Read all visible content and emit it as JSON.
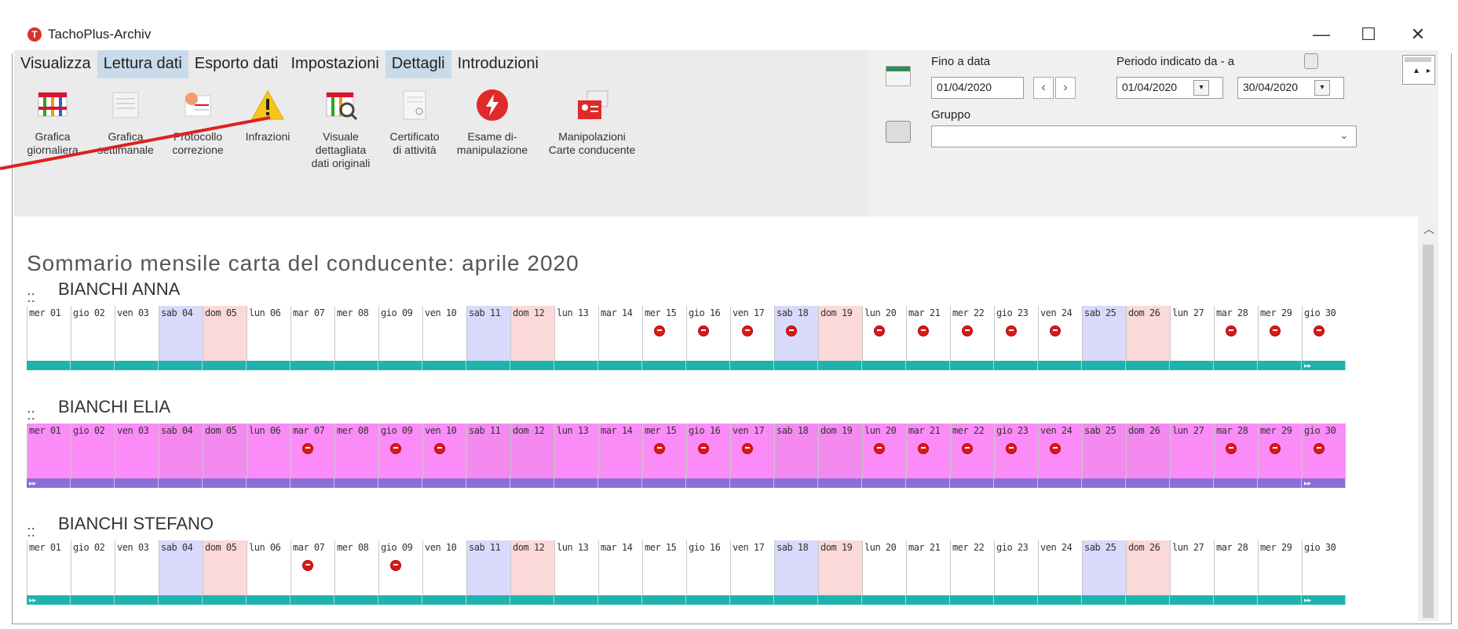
{
  "window": {
    "title": "TachoPlus-Archiv",
    "minimize": "—",
    "maximize": "☐",
    "close": "✕",
    "app_icon_letter": "T"
  },
  "menu": [
    {
      "label": "Visualizza",
      "active": false
    },
    {
      "label": "Lettura dati",
      "active": true
    },
    {
      "label": "Esporto dati",
      "active": false
    },
    {
      "label": "Impostazioni",
      "active": false
    },
    {
      "label": "Dettagli",
      "active": true
    },
    {
      "label": "Introduzioni",
      "active": false
    }
  ],
  "tools": [
    {
      "lines": [
        "Grafica",
        "giornaliera"
      ],
      "icon": "daily-chart-icon"
    },
    {
      "lines": [
        "Grafica",
        "settimanale"
      ],
      "icon": "weekly-chart-icon"
    },
    {
      "lines": [
        "Protocollo",
        "correzione"
      ],
      "icon": "correction-protocol-icon"
    },
    {
      "lines": [
        "Infrazioni"
      ],
      "icon": "warning-icon"
    },
    {
      "lines": [
        "Visuale",
        "dettagliata",
        "dati originali"
      ],
      "icon": "detail-view-icon"
    },
    {
      "lines": [
        "Certificato",
        "di attività"
      ],
      "icon": "certificate-icon"
    },
    {
      "lines": [
        "Esame di-",
        "manipulazione"
      ],
      "icon": "lightning-icon"
    },
    {
      "lines": [
        "Manipolazioni",
        "Carte conducente"
      ],
      "icon": "driver-card-icon"
    }
  ],
  "filters": {
    "fino_label": "Fino a data",
    "fino_value": "01/04/2020",
    "periodo_label": "Periodo indicato da - a",
    "periodo_from": "01/04/2020",
    "periodo_to": "30/04/2020",
    "gruppo_label": "Gruppo",
    "gruppo_value": ""
  },
  "summary": {
    "title": "Sommario mensile carta del conducente: aprile 2020",
    "prefix": "::"
  },
  "days": [
    "mer 01",
    "gio 02",
    "ven 03",
    "sab 04",
    "dom 05",
    "lun 06",
    "mar 07",
    "mer 08",
    "gio 09",
    "ven 10",
    "sab 11",
    "dom 12",
    "lun 13",
    "mar 14",
    "mer 15",
    "gio 16",
    "ven 17",
    "sab 18",
    "dom 19",
    "lun 20",
    "mar 21",
    "mer 22",
    "gio 23",
    "ven 24",
    "sab 25",
    "dom 26",
    "lun 27",
    "mar 28",
    "mer 29",
    "gio 30"
  ],
  "colors": {
    "saturday": "#d9d9fb",
    "sunday": "#fcd9d9",
    "teal": "#1fb3ad",
    "magenta_bg": "#fb8cf7",
    "magenta_bar": "#8a6fd6",
    "infraction": "#d81a1a",
    "annotation": "#e02020"
  },
  "drivers": [
    {
      "name": "BIANCHI ANNA",
      "style": "normal",
      "infractions": [
        15,
        16,
        17,
        18,
        20,
        21,
        22,
        23,
        24,
        28,
        29,
        30
      ],
      "bar_marks": {
        "30": "▸▸"
      }
    },
    {
      "name": "BIANCHI ELIA",
      "style": "magenta",
      "infractions": [
        7,
        9,
        10,
        15,
        16,
        17,
        20,
        21,
        22,
        23,
        24,
        28,
        29,
        30
      ],
      "bar_marks": {
        "1": "▸▸",
        "30": "▸▸"
      }
    },
    {
      "name": "BIANCHI STEFANO",
      "style": "normal",
      "infractions": [
        7,
        9
      ],
      "bar_marks": {
        "1": "▸▸",
        "30": "▸▸"
      }
    }
  ]
}
